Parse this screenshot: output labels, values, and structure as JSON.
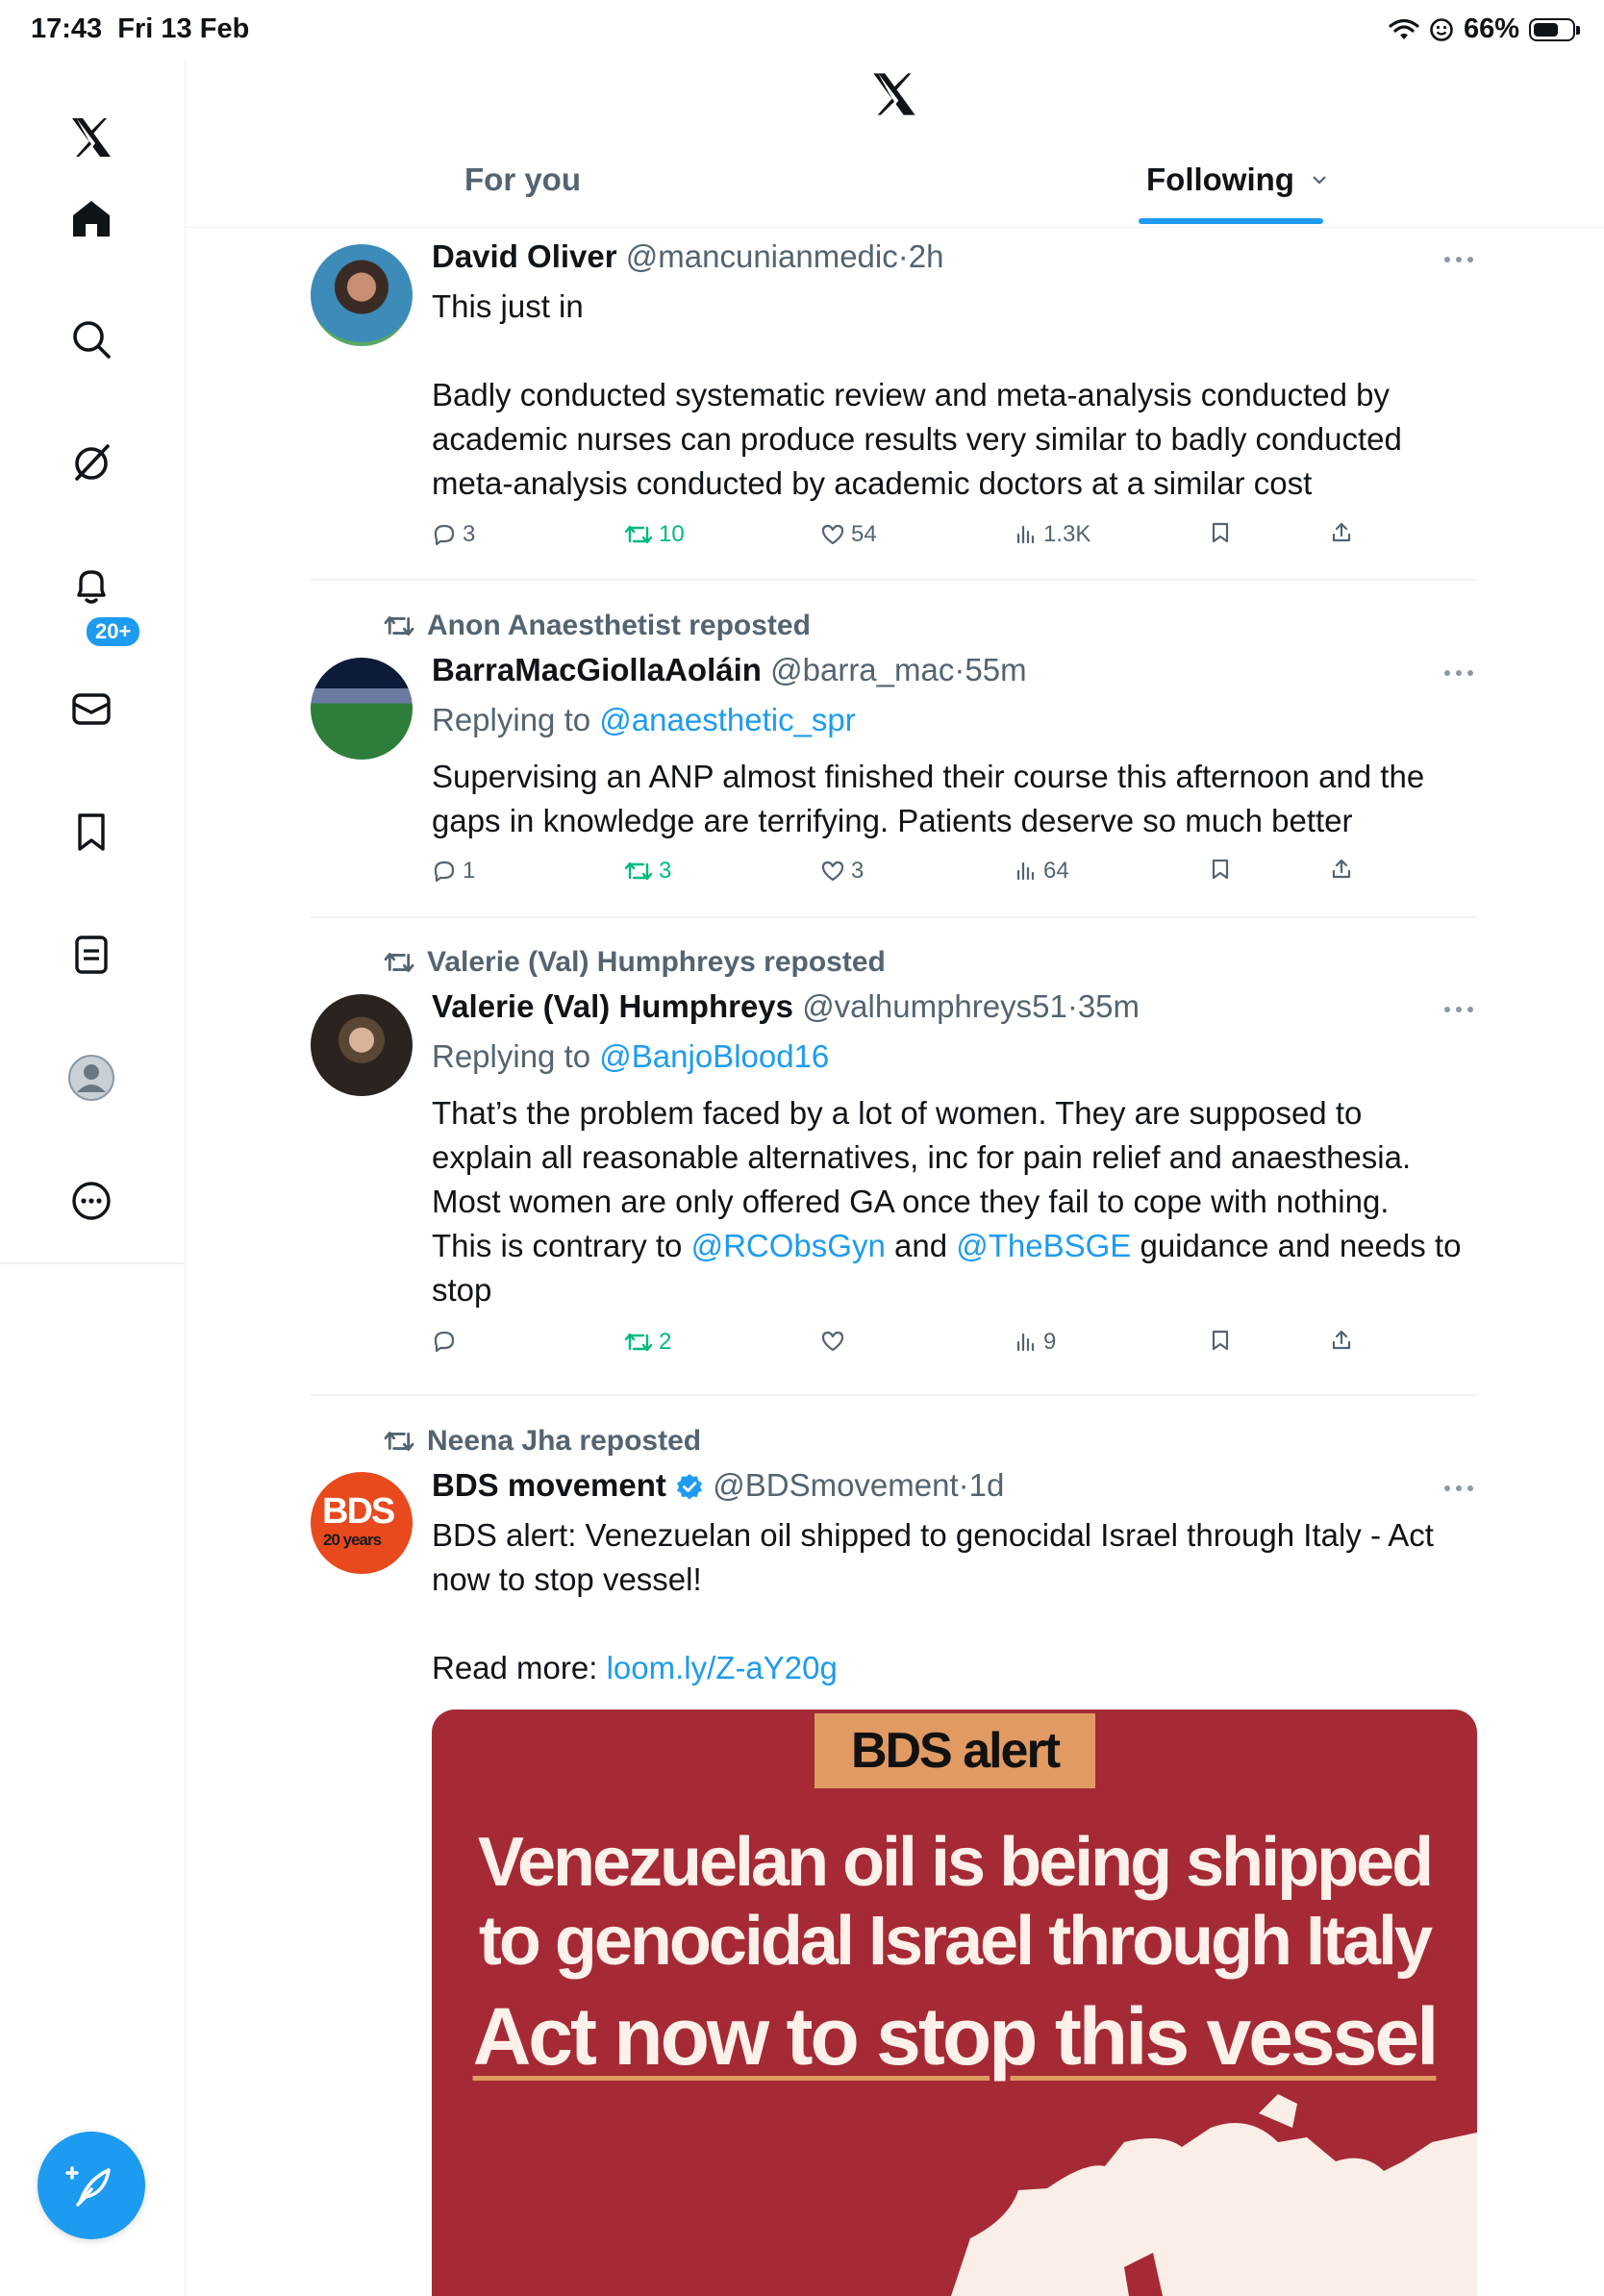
{
  "status_bar": {
    "time": "17:43",
    "date": "Fri 13 Feb",
    "battery_text": "66%",
    "battery_level": 0.66
  },
  "sidebar": {
    "logo": "x-logo",
    "items": [
      {
        "icon": "home-icon"
      },
      {
        "icon": "search-icon"
      },
      {
        "icon": "grok-icon"
      },
      {
        "icon": "notifications-icon",
        "badge": "20+"
      },
      {
        "icon": "messages-icon"
      },
      {
        "icon": "bookmarks-icon"
      },
      {
        "icon": "lists-icon"
      },
      {
        "icon": "profile-icon"
      },
      {
        "icon": "more-icon"
      }
    ],
    "compose_icon": "compose-icon"
  },
  "header": {
    "logo": "x-logo",
    "tabs": [
      "For you",
      "Following"
    ],
    "active_tab": "Following"
  },
  "tweets": [
    {
      "author": "David Oliver",
      "handle": "@mancunianmedic",
      "sep": "·",
      "time": "2h",
      "text_1": "This just in",
      "text_2": "Badly conducted systematic review and meta-analysis conducted by",
      "text_3": "academic nurses can produce results very similar to badly conducted",
      "text_4": "meta-analysis conducted by academic doctors at a similar cost",
      "replies": "3",
      "reposts": "10",
      "likes": "54",
      "views": "1.3K"
    },
    {
      "reposted_by": "Anon Anaesthetist reposted",
      "author": "BarraMacGiollaAoláin",
      "handle": "@barra_mac",
      "sep": "·",
      "time": "55m",
      "replying_prefix": "Replying to",
      "replying_to": "@anaesthetic_spr",
      "text_1": "Supervising an ANP almost finished their course this afternoon and the",
      "text_2": "gaps in knowledge are terrifying. Patients deserve so much better",
      "replies": "1",
      "reposts": "3",
      "likes": "3",
      "views": "64"
    },
    {
      "reposted_by": "Valerie (Val) Humphreys reposted",
      "author": "Valerie (Val) Humphreys",
      "handle": "@valhumphreys51",
      "sep": "·",
      "time": "35m",
      "replying_prefix": "Replying to",
      "replying_to": "@BanjoBlood16",
      "text_1": "That’s the problem faced by a lot of women. They are supposed to",
      "text_2": "explain all reasonable alternatives, inc for pain relief and anaesthesia.",
      "text_3": "Most women are only offered GA once they fail to cope with nothing.",
      "text_4a": "This is contrary to",
      "mention_1": "@RCObsGyn",
      "text_4b": "and",
      "mention_2": "@TheBSGE",
      "text_4c": "guidance and needs to",
      "text_5": "stop",
      "reposts": "2",
      "views": "9"
    },
    {
      "reposted_by": "Neena Jha reposted",
      "author": "BDS movement",
      "handle": "@BDSmovement",
      "sep": "·",
      "time": "1d",
      "verified": true,
      "avatar_text_1": "BDS",
      "avatar_text_2": "20 years",
      "text_1": "BDS alert:  Venezuelan oil shipped to genocidal Israel through Italy - Act",
      "text_2": "now to stop vessel!",
      "read_more": "Read more:",
      "link": "loom.ly/Z-aY20g",
      "card": {
        "label": "BDS alert",
        "headline_1": "Venezuelan oil is being shipped",
        "headline_2": "to genocidal Israel through Italy",
        "headline_3": "Act now to stop this vessel"
      }
    }
  ],
  "colors": {
    "accent": "#1d9bf0",
    "repost_green": "#00ba7c",
    "muted": "#536471",
    "card_red": "#a52a35",
    "card_orange": "#e09a62"
  }
}
